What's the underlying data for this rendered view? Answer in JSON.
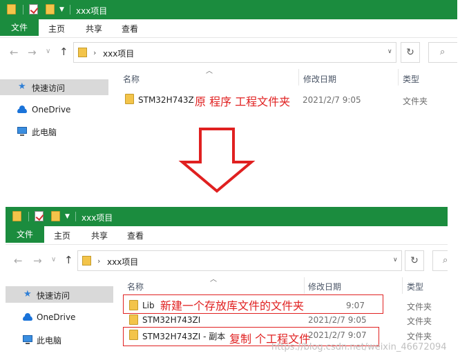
{
  "top": {
    "title": "xxx项目",
    "ribbon_tabs": [
      "文件",
      "主页",
      "共享",
      "查看"
    ],
    "address_path": "xxx项目",
    "sidebar": [
      "快速访问",
      "OneDrive",
      "此电脑"
    ],
    "columns": [
      "名称",
      "修改日期",
      "类型"
    ],
    "rows": [
      {
        "name": "STM32H743ZI",
        "date": "2021/2/7 9:05",
        "type": "文件夹"
      }
    ],
    "annotation": "原 程序 工程文件夹"
  },
  "bottom": {
    "title": "xxx项目",
    "ribbon_tabs": [
      "文件",
      "主页",
      "共享",
      "查看"
    ],
    "address_path": "xxx项目",
    "sidebar": [
      "快速访问",
      "OneDrive",
      "此电脑"
    ],
    "columns": [
      "名称",
      "修改日期",
      "类型"
    ],
    "rows": [
      {
        "name": "Lib",
        "date": "9:07",
        "type": "文件夹"
      },
      {
        "name": "STM32H743ZI",
        "date": "2021/2/7 9:05",
        "type": "文件夹"
      },
      {
        "name": "STM32H743ZI - 副本",
        "date": "2021/2/7 9:07",
        "type": "文件夹"
      }
    ],
    "annotations": [
      "新建一个存放库文件的文件夹",
      "复制 个工程文件"
    ]
  },
  "watermark": "https://blog.csdn.net/weixin_46672094",
  "colors": {
    "ribbon_green": "#1b8c3e",
    "annotation_red": "#e02020",
    "folder_yellow": "#f3c44a",
    "selected_gray": "#d9d9d9"
  },
  "icons": [
    "folder-icon",
    "checkmark-icon",
    "back-arrow-icon",
    "forward-arrow-icon",
    "up-arrow-icon",
    "refresh-icon",
    "search-icon",
    "star-icon",
    "cloud-icon",
    "computer-icon",
    "down-arrow-icon"
  ]
}
